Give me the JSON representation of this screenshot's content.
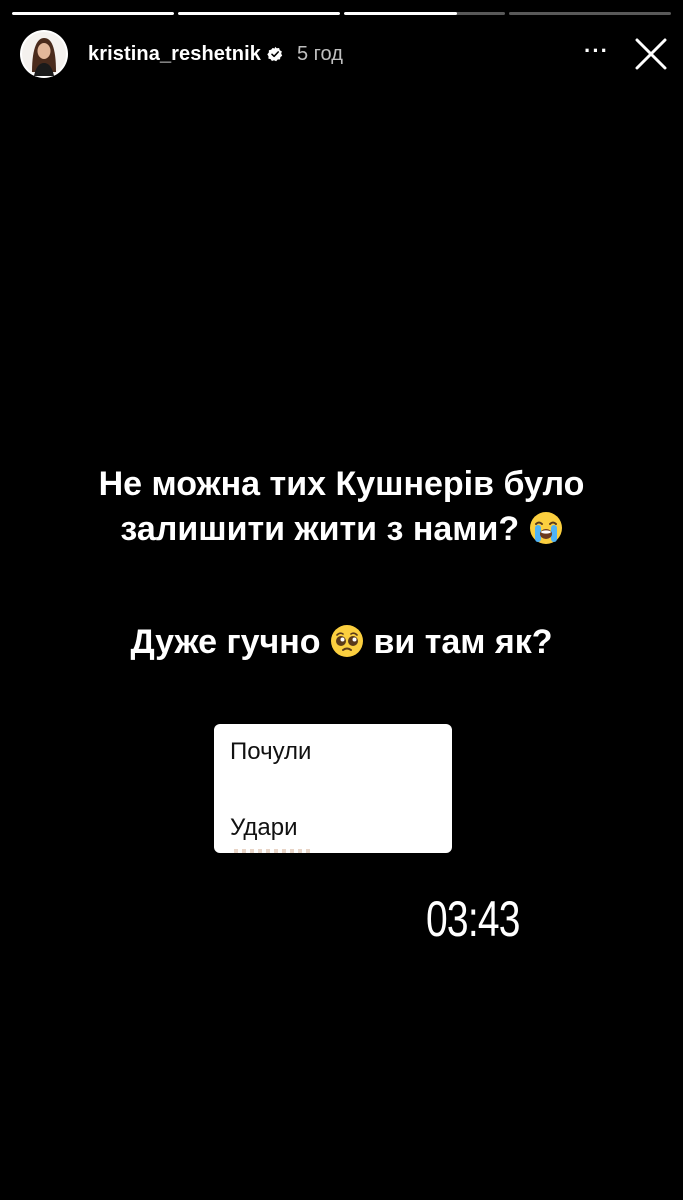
{
  "story": {
    "progress_segments": [
      {
        "fill": 1.0
      },
      {
        "fill": 1.0
      },
      {
        "fill": 0.7
      },
      {
        "fill": 0.0
      }
    ],
    "header": {
      "username": "kristina_reshetnik",
      "time": "5 год",
      "more_label": "···",
      "verified_icon": "verified-badge-icon",
      "close_icon": "close-icon"
    },
    "text": {
      "line1": "Не можна тих Кушнерів було",
      "line2": "залишити жити з нами?",
      "line2_emoji": "loudly-crying-face-emoji",
      "line3_part1": "Дуже гучно",
      "line3_emoji": "pleading-face-emoji",
      "line3_part2": "ви там як?"
    },
    "poll": {
      "option1": "Почули",
      "option2": "Удари"
    },
    "clock": "03:43"
  }
}
